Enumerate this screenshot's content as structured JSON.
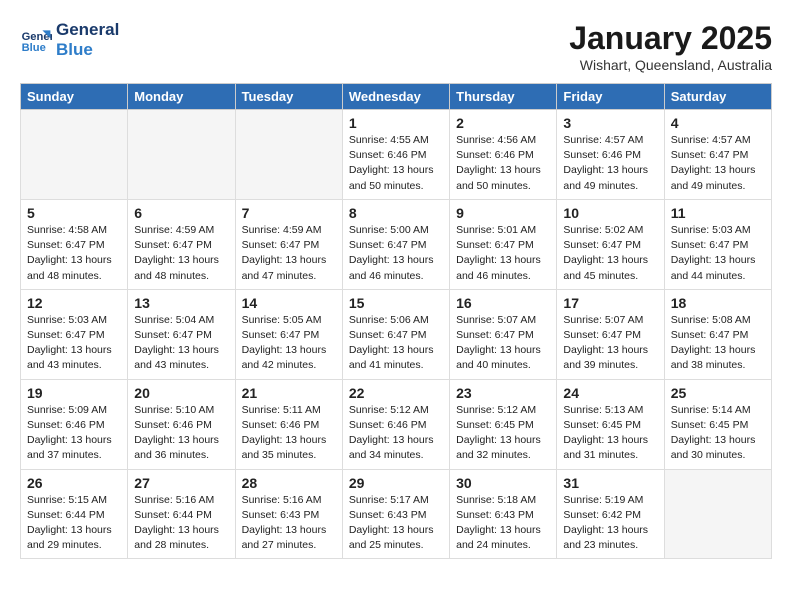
{
  "header": {
    "logo_line1": "General",
    "logo_line2": "Blue",
    "month": "January 2025",
    "location": "Wishart, Queensland, Australia"
  },
  "weekdays": [
    "Sunday",
    "Monday",
    "Tuesday",
    "Wednesday",
    "Thursday",
    "Friday",
    "Saturday"
  ],
  "weeks": [
    [
      {
        "day": "",
        "info": ""
      },
      {
        "day": "",
        "info": ""
      },
      {
        "day": "",
        "info": ""
      },
      {
        "day": "1",
        "info": "Sunrise: 4:55 AM\nSunset: 6:46 PM\nDaylight: 13 hours\nand 50 minutes."
      },
      {
        "day": "2",
        "info": "Sunrise: 4:56 AM\nSunset: 6:46 PM\nDaylight: 13 hours\nand 50 minutes."
      },
      {
        "day": "3",
        "info": "Sunrise: 4:57 AM\nSunset: 6:46 PM\nDaylight: 13 hours\nand 49 minutes."
      },
      {
        "day": "4",
        "info": "Sunrise: 4:57 AM\nSunset: 6:47 PM\nDaylight: 13 hours\nand 49 minutes."
      }
    ],
    [
      {
        "day": "5",
        "info": "Sunrise: 4:58 AM\nSunset: 6:47 PM\nDaylight: 13 hours\nand 48 minutes."
      },
      {
        "day": "6",
        "info": "Sunrise: 4:59 AM\nSunset: 6:47 PM\nDaylight: 13 hours\nand 48 minutes."
      },
      {
        "day": "7",
        "info": "Sunrise: 4:59 AM\nSunset: 6:47 PM\nDaylight: 13 hours\nand 47 minutes."
      },
      {
        "day": "8",
        "info": "Sunrise: 5:00 AM\nSunset: 6:47 PM\nDaylight: 13 hours\nand 46 minutes."
      },
      {
        "day": "9",
        "info": "Sunrise: 5:01 AM\nSunset: 6:47 PM\nDaylight: 13 hours\nand 46 minutes."
      },
      {
        "day": "10",
        "info": "Sunrise: 5:02 AM\nSunset: 6:47 PM\nDaylight: 13 hours\nand 45 minutes."
      },
      {
        "day": "11",
        "info": "Sunrise: 5:03 AM\nSunset: 6:47 PM\nDaylight: 13 hours\nand 44 minutes."
      }
    ],
    [
      {
        "day": "12",
        "info": "Sunrise: 5:03 AM\nSunset: 6:47 PM\nDaylight: 13 hours\nand 43 minutes."
      },
      {
        "day": "13",
        "info": "Sunrise: 5:04 AM\nSunset: 6:47 PM\nDaylight: 13 hours\nand 43 minutes."
      },
      {
        "day": "14",
        "info": "Sunrise: 5:05 AM\nSunset: 6:47 PM\nDaylight: 13 hours\nand 42 minutes."
      },
      {
        "day": "15",
        "info": "Sunrise: 5:06 AM\nSunset: 6:47 PM\nDaylight: 13 hours\nand 41 minutes."
      },
      {
        "day": "16",
        "info": "Sunrise: 5:07 AM\nSunset: 6:47 PM\nDaylight: 13 hours\nand 40 minutes."
      },
      {
        "day": "17",
        "info": "Sunrise: 5:07 AM\nSunset: 6:47 PM\nDaylight: 13 hours\nand 39 minutes."
      },
      {
        "day": "18",
        "info": "Sunrise: 5:08 AM\nSunset: 6:47 PM\nDaylight: 13 hours\nand 38 minutes."
      }
    ],
    [
      {
        "day": "19",
        "info": "Sunrise: 5:09 AM\nSunset: 6:46 PM\nDaylight: 13 hours\nand 37 minutes."
      },
      {
        "day": "20",
        "info": "Sunrise: 5:10 AM\nSunset: 6:46 PM\nDaylight: 13 hours\nand 36 minutes."
      },
      {
        "day": "21",
        "info": "Sunrise: 5:11 AM\nSunset: 6:46 PM\nDaylight: 13 hours\nand 35 minutes."
      },
      {
        "day": "22",
        "info": "Sunrise: 5:12 AM\nSunset: 6:46 PM\nDaylight: 13 hours\nand 34 minutes."
      },
      {
        "day": "23",
        "info": "Sunrise: 5:12 AM\nSunset: 6:45 PM\nDaylight: 13 hours\nand 32 minutes."
      },
      {
        "day": "24",
        "info": "Sunrise: 5:13 AM\nSunset: 6:45 PM\nDaylight: 13 hours\nand 31 minutes."
      },
      {
        "day": "25",
        "info": "Sunrise: 5:14 AM\nSunset: 6:45 PM\nDaylight: 13 hours\nand 30 minutes."
      }
    ],
    [
      {
        "day": "26",
        "info": "Sunrise: 5:15 AM\nSunset: 6:44 PM\nDaylight: 13 hours\nand 29 minutes."
      },
      {
        "day": "27",
        "info": "Sunrise: 5:16 AM\nSunset: 6:44 PM\nDaylight: 13 hours\nand 28 minutes."
      },
      {
        "day": "28",
        "info": "Sunrise: 5:16 AM\nSunset: 6:43 PM\nDaylight: 13 hours\nand 27 minutes."
      },
      {
        "day": "29",
        "info": "Sunrise: 5:17 AM\nSunset: 6:43 PM\nDaylight: 13 hours\nand 25 minutes."
      },
      {
        "day": "30",
        "info": "Sunrise: 5:18 AM\nSunset: 6:43 PM\nDaylight: 13 hours\nand 24 minutes."
      },
      {
        "day": "31",
        "info": "Sunrise: 5:19 AM\nSunset: 6:42 PM\nDaylight: 13 hours\nand 23 minutes."
      },
      {
        "day": "",
        "info": ""
      }
    ]
  ]
}
